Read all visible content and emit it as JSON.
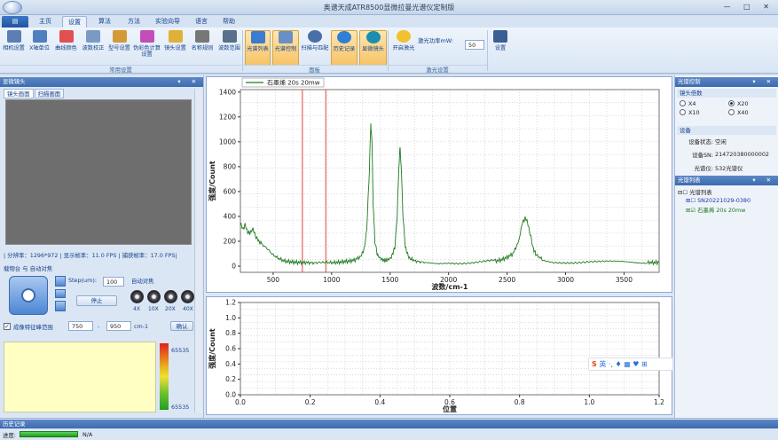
{
  "window": {
    "title": "奥谱天成ATR8500显微拉曼光谱仪定制版",
    "controls": "—  □  ✕"
  },
  "tabs": [
    {
      "label": "",
      "kind": "file"
    },
    {
      "label": "主页"
    },
    {
      "label": "设置",
      "active": true
    },
    {
      "label": "算法"
    },
    {
      "label": "方法"
    },
    {
      "label": "实验向导"
    },
    {
      "label": "语言"
    },
    {
      "label": "帮助"
    }
  ],
  "ribbon": {
    "buttons": [
      {
        "label": "相机设置",
        "icon": "camera-icon",
        "color": "#5b7fb5"
      },
      {
        "label": "X轴单位",
        "icon": "axis-unit-icon",
        "color": "#4f7fbf"
      },
      {
        "label": "曲线颜色",
        "icon": "curve-color-icon",
        "color": "#e05050"
      },
      {
        "label": "波数校正",
        "icon": "wavenumber-correct-icon",
        "color": "#7a9ac4"
      },
      {
        "label": "型号设置",
        "icon": "model-settings-icon",
        "color": "#d49a3a"
      },
      {
        "label": "伪彩色计算设置",
        "icon": "pseudo-color-icon",
        "color": "#c24fb8"
      },
      {
        "label": "镜头设置",
        "icon": "lens-settings-icon",
        "color": "#e0b13a"
      },
      {
        "label": "名称规则",
        "icon": "name-rule-icon",
        "color": "#777777"
      },
      {
        "label": "波数范围",
        "icon": "wavenumber-range-icon",
        "color": "#5a6f8c"
      },
      {
        "label": "光谱列表",
        "icon": "spectrum-list-icon",
        "color": "#3d7bd0",
        "on": true
      },
      {
        "label": "光谱控制",
        "icon": "spectrum-control-icon",
        "color": "#6a8fc4",
        "on": true
      },
      {
        "label": "扫描与匹配",
        "icon": "scan-match-icon",
        "color": "#4a6fa8"
      },
      {
        "label": "历史记录",
        "icon": "history-icon",
        "color": "#2f7fd6",
        "on": true
      },
      {
        "label": "显微镜头",
        "icon": "microscope-icon",
        "color": "#1c8fb0",
        "on": true
      },
      {
        "label": "开启激光",
        "icon": "laser-icon",
        "color": "#f2c12e"
      },
      {
        "label": "设置",
        "icon": "settings-save-icon",
        "color": "#3b5f94"
      }
    ],
    "groups": [
      "常用设置",
      "面板",
      "激光设置"
    ],
    "laser_power_label": "激光功率mW:",
    "laser_power_value": "50"
  },
  "left": {
    "header": "显微镜头",
    "cam_tabs": [
      "镜头画面",
      "扫描画面"
    ],
    "status": "| 分辨率：1296*972 | 显示帧率：11.0 FPS | 捕获帧率：17.0 FPS|",
    "stage_header": "载物台 与 自动对焦",
    "step_label": "Step(um):",
    "step_value": "100",
    "stop_label": "停止",
    "autofocus_label": "自动对焦",
    "lenses": [
      "4X",
      "10X",
      "20X",
      "40X"
    ],
    "imaging_label": "成像特征峰范围",
    "range_from": "750",
    "range_to": "950",
    "range_unit": "cm-1",
    "confirm_label": "确认",
    "cbar_top": "65535",
    "cbar_bottom": "65535"
  },
  "right": {
    "header": "光谱控制",
    "lens_section": "镜头倍数",
    "lens_options": [
      {
        "label": "X4",
        "on": false
      },
      {
        "label": "X20",
        "on": true
      },
      {
        "label": "X10",
        "on": false
      },
      {
        "label": "X40",
        "on": false
      }
    ],
    "device_section": "设备",
    "device": [
      {
        "k": "设备状态:",
        "v": "空闲"
      },
      {
        "k": "设备SN:",
        "v": "214720380000002"
      },
      {
        "k": "光谱仪:",
        "v": "532光谱仪"
      }
    ],
    "list_header": "光谱列表",
    "tree": {
      "root": "光谱列表",
      "node": "SN20221029-0380",
      "leaf": "石墨烯    20s 20mw"
    }
  },
  "ime_text": "英 ·, ♦ ▦ ♥ ⊞",
  "bottom": {
    "history": "历史记录",
    "progress_label": "进度:",
    "progress_text": "N/A",
    "progress_fraction": 1.0
  },
  "chart_data": [
    {
      "type": "line",
      "legend": [
        "石墨烯    20s 20mw"
      ],
      "xlabel": "波数/cm-1",
      "ylabel": "强度/Count",
      "xlim": [
        220,
        3800
      ],
      "ylim": [
        -50,
        1420
      ],
      "xticks": [
        500,
        1000,
        1500,
        2000,
        2500,
        3000,
        3500
      ],
      "yticks": [
        0,
        200,
        400,
        600,
        800,
        1000,
        1200,
        1400
      ],
      "markers": [
        750,
        950
      ],
      "series": [
        {
          "name": "石墨烯    20s 20mw",
          "color": "#1f7a1f",
          "x": [
            220,
            240,
            260,
            280,
            300,
            320,
            340,
            360,
            380,
            400,
            450,
            500,
            550,
            600,
            650,
            700,
            750,
            800,
            850,
            900,
            950,
            1000,
            1050,
            1100,
            1150,
            1200,
            1250,
            1280,
            1300,
            1320,
            1335,
            1345,
            1355,
            1370,
            1390,
            1420,
            1450,
            1480,
            1510,
            1540,
            1560,
            1575,
            1585,
            1595,
            1610,
            1630,
            1660,
            1700,
            1750,
            1800,
            1900,
            2000,
            2100,
            2200,
            2300,
            2400,
            2450,
            2500,
            2550,
            2600,
            2630,
            2660,
            2680,
            2700,
            2720,
            2750,
            2800,
            2900,
            3000,
            3100,
            3200,
            3300,
            3400,
            3500,
            3600,
            3700,
            3750,
            3800
          ],
          "y": [
            340,
            300,
            330,
            280,
            260,
            300,
            270,
            220,
            200,
            180,
            140,
            90,
            60,
            40,
            35,
            30,
            30,
            28,
            25,
            30,
            30,
            28,
            30,
            35,
            40,
            50,
            80,
            140,
            300,
            700,
            1150,
            1000,
            500,
            200,
            90,
            60,
            45,
            50,
            70,
            150,
            400,
            800,
            950,
            800,
            400,
            150,
            70,
            45,
            35,
            30,
            28,
            35,
            30,
            30,
            35,
            40,
            50,
            70,
            100,
            200,
            350,
            390,
            330,
            250,
            150,
            90,
            55,
            40,
            35,
            30,
            30,
            28,
            28,
            30,
            28,
            30,
            28,
            30
          ]
        }
      ]
    },
    {
      "type": "line",
      "xlabel": "位置",
      "ylabel": "强度/Count",
      "xlim": [
        0,
        1.2
      ],
      "ylim": [
        0,
        1.2
      ],
      "xticks": [
        0.0,
        0.2,
        0.4,
        0.6,
        0.8,
        1.0,
        1.2
      ],
      "yticks": [
        0.0,
        0.2,
        0.4,
        0.6,
        0.8,
        1.0,
        1.2
      ],
      "series": []
    }
  ]
}
